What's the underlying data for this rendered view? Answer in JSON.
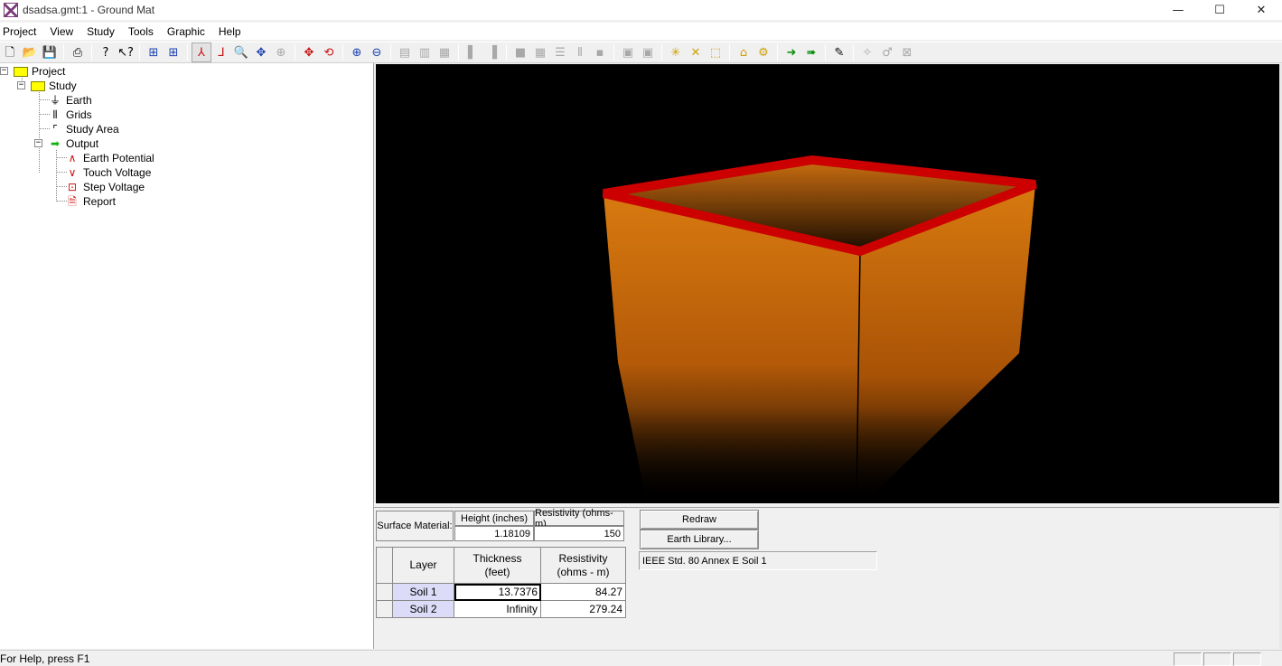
{
  "window": {
    "title": "dsadsa.gmt:1 - Ground Mat"
  },
  "menu": [
    "Project",
    "View",
    "Study",
    "Tools",
    "Graphic",
    "Help"
  ],
  "tree": {
    "root": "Project",
    "study": "Study",
    "earth": "Earth",
    "grids": "Grids",
    "study_area": "Study Area",
    "output": "Output",
    "earth_potential": "Earth Potential",
    "touch_voltage": "Touch Voltage",
    "step_voltage": "Step Voltage",
    "report": "Report"
  },
  "surface": {
    "label": "Surface Material:",
    "height_header": "Height (inches)",
    "resistivity_header": "Resistivity (ohms-m)",
    "height_value": "1.18109",
    "resistivity_value": "150"
  },
  "layers": {
    "col_layer": "Layer",
    "col_thickness_1": "Thickness",
    "col_thickness_2": "(feet)",
    "col_resistivity_1": "Resistivity",
    "col_resistivity_2": "(ohms - m)",
    "rows": [
      {
        "name": "Soil 1",
        "thickness": "13.7376",
        "resistivity": "84.27"
      },
      {
        "name": "Soil 2",
        "thickness": "Infinity",
        "resistivity": "279.24"
      }
    ]
  },
  "buttons": {
    "redraw": "Redraw",
    "earth_library": "Earth Library..."
  },
  "earth_library_name": "IEEE Std. 80 Annex E Soil 1",
  "status": {
    "help": "For Help, press F1"
  },
  "colors": {
    "soil": "#d4700a",
    "rim": "#cc0000",
    "view_bg": "#000000"
  }
}
